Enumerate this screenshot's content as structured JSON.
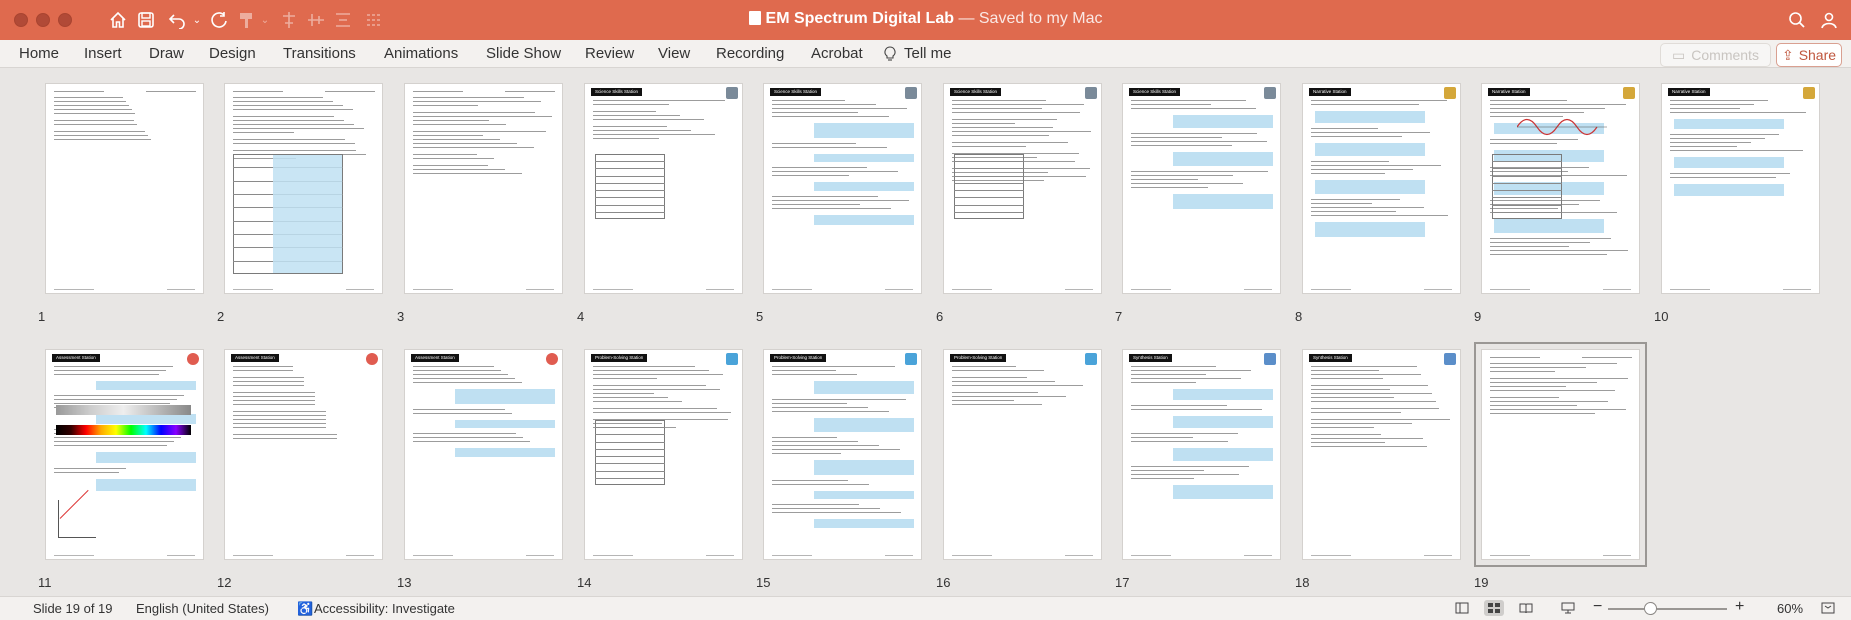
{
  "window": {
    "app_icon": "powerpoint-doc-icon",
    "title": "EM Spectrum Digital Lab",
    "title_suffix": "— Saved to my Mac"
  },
  "toolbar_icons": [
    "home-icon",
    "save-icon",
    "undo-icon",
    "redo-icon",
    "format-painter-icon",
    "align-icon",
    "distribute-icon",
    "search-icon",
    "account-icon"
  ],
  "ribbon": {
    "tabs": [
      "Home",
      "Insert",
      "Draw",
      "Design",
      "Transitions",
      "Animations",
      "Slide Show",
      "Review",
      "View",
      "Recording",
      "Acrobat"
    ],
    "tell_me": "Tell me",
    "comments_label": "Comments",
    "share_label": "Share"
  },
  "slides": [
    {
      "number": "1",
      "header": ""
    },
    {
      "number": "2",
      "header": ""
    },
    {
      "number": "3",
      "header": ""
    },
    {
      "number": "4",
      "header": "Science Skills Station"
    },
    {
      "number": "5",
      "header": "Science Skills Station"
    },
    {
      "number": "6",
      "header": "Science Skills Station"
    },
    {
      "number": "7",
      "header": "Science Skills Station"
    },
    {
      "number": "8",
      "header": "Narrative Station"
    },
    {
      "number": "9",
      "header": "Narrative Station"
    },
    {
      "number": "10",
      "header": "Narrative Station"
    },
    {
      "number": "11",
      "header": "Assessment Station"
    },
    {
      "number": "12",
      "header": "Assessment Station"
    },
    {
      "number": "13",
      "header": "Assessment Station"
    },
    {
      "number": "14",
      "header": "Problem-Solving Station"
    },
    {
      "number": "15",
      "header": "Problem-Solving Station"
    },
    {
      "number": "16",
      "header": "Problem-Solving Station"
    },
    {
      "number": "17",
      "header": "Synthesis Station"
    },
    {
      "number": "18",
      "header": "Synthesis Station"
    },
    {
      "number": "19",
      "header": ""
    }
  ],
  "status_bar": {
    "slide_indicator": "Slide 19 of 19",
    "language": "English (United States)",
    "accessibility": "Accessibility: Investigate",
    "zoom": "60%",
    "zoom_minus": "−",
    "zoom_plus": "+"
  },
  "colors": {
    "titlebar": "#df6a4e",
    "highlight_blue": "#bfe0f2",
    "share_accent": "#c0573e"
  }
}
